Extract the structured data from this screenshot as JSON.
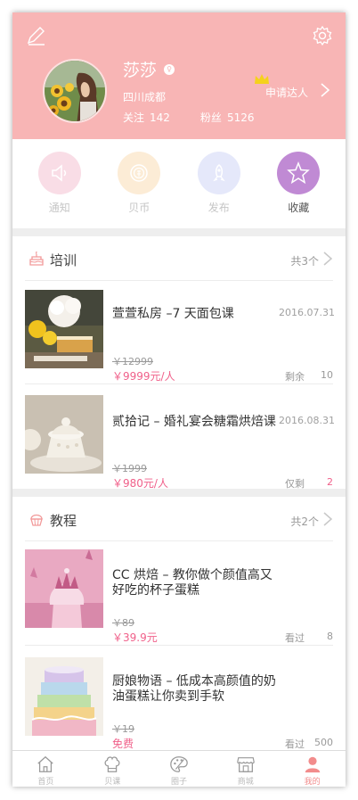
{
  "profile": {
    "name": "莎莎",
    "location": "四川成都",
    "follow_label": "关注",
    "follow_count": "142",
    "fans_label": "粉丝",
    "fans_count": "5126",
    "apply_label": "申请达人"
  },
  "quick_actions": [
    {
      "label": "通知",
      "icon": "speaker-icon",
      "color": "#f9dde6",
      "active": false
    },
    {
      "label": "贝币",
      "icon": "coin-icon",
      "color": "#fcecd6",
      "active": false
    },
    {
      "label": "发布",
      "icon": "publish-icon",
      "color": "#e5e8fa",
      "active": false
    },
    {
      "label": "收藏",
      "icon": "star-icon",
      "color": "#c08ad4",
      "active": true
    }
  ],
  "training": {
    "title": "培训",
    "count": "共3个",
    "items": [
      {
        "title": "萱萱私房 –7 天面包课",
        "date": "2016.07.31",
        "old_price": "￥12999",
        "price": "￥9999元/人",
        "meta_label": "剩余",
        "meta_value": "10"
      },
      {
        "title": "贰拾记 – 婚礼宴会糖霜烘焙课",
        "date": "2016.08.31",
        "old_price": "￥1999",
        "price": "￥980元/人",
        "meta_label": "仅剩",
        "meta_value": "2"
      }
    ]
  },
  "tutorial": {
    "title": "教程",
    "count": "共2个",
    "items": [
      {
        "title": "CC 烘焙 – 教你做个颜值高又好吃的杯子蛋糕",
        "old_price": "￥89",
        "price": "￥39.9元",
        "meta_label": "看过",
        "meta_value": "8"
      },
      {
        "title": "厨娘物语 – 低成本高颜值的奶油蛋糕让你卖到手软",
        "old_price": "￥19",
        "price": "免费",
        "meta_label": "看过",
        "meta_value": "500"
      }
    ]
  },
  "tabs": [
    {
      "label": "首页",
      "icon": "home-icon",
      "active": false
    },
    {
      "label": "贝课",
      "icon": "chef-hat-icon",
      "active": false
    },
    {
      "label": "圈子",
      "icon": "palette-icon",
      "active": false
    },
    {
      "label": "商城",
      "icon": "shop-icon",
      "active": false
    },
    {
      "label": "我的",
      "icon": "person-icon",
      "active": true
    }
  ],
  "colors": {
    "header_bg": "#f8b5b5",
    "price": "#f0608a",
    "accent_tab": "#f28c8c"
  }
}
